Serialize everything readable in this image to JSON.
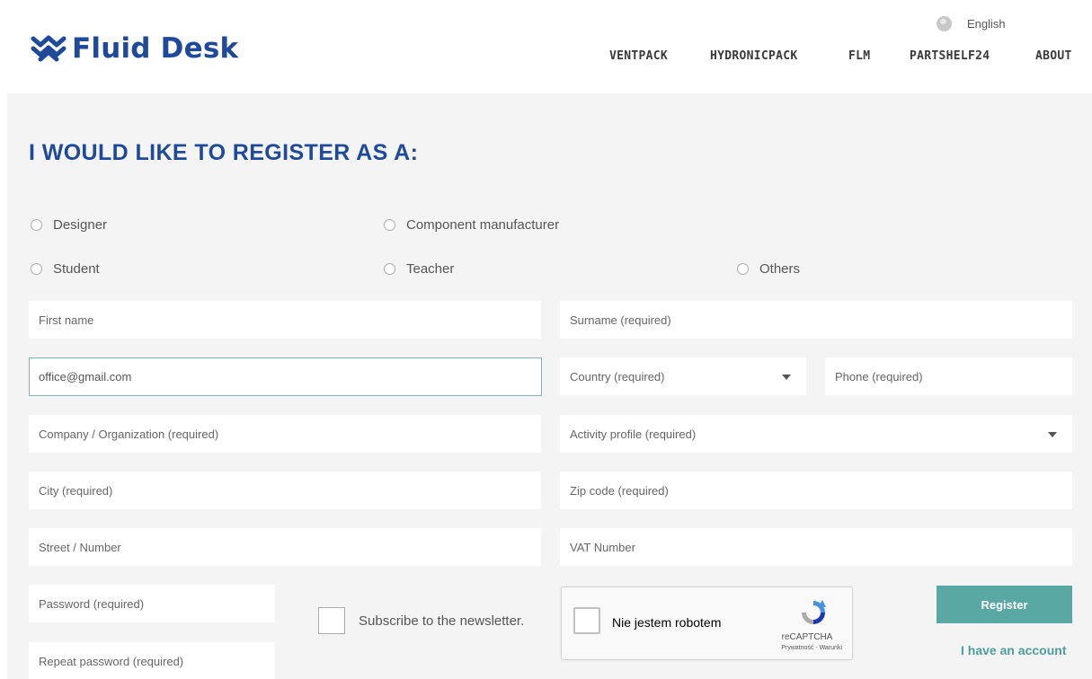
{
  "header": {
    "logo_text": "Fluid Desk",
    "language": "English",
    "nav": [
      "VENTPACK",
      "HYDRONICPACK",
      "FLM",
      "PARTSHELF24",
      "ABOUT"
    ]
  },
  "main": {
    "title": "I WOULD LIKE TO REGISTER AS A:",
    "roles": [
      "Designer",
      "Component manufacturer",
      "Student",
      "Teacher",
      "Others"
    ],
    "fields": {
      "first_name": "First name",
      "surname": "Surname (required)",
      "email_value": "office@gmail.com",
      "country": "Country (required)",
      "phone": "Phone (required)",
      "company": "Company / Organization (required)",
      "activity_profile": "Activity profile (required)",
      "city": "City (required)",
      "zip_code": "Zip code (required)",
      "street": "Street / Number",
      "vat": "VAT Number",
      "password": "Password (required)",
      "repeat_password": "Repeat password (required)"
    },
    "newsletter_label": "Subscribe to the newsletter.",
    "captcha": {
      "label": "Nie jestem robotem",
      "brand": "reCAPTCHA",
      "links": "Prywatność - Warunki"
    },
    "register_label": "Register",
    "account_link": "I have an account"
  },
  "colors": {
    "brand_blue": "#1f4a9a",
    "accent_teal": "#5aa8a3",
    "panel_bg": "#f4f4f4"
  }
}
